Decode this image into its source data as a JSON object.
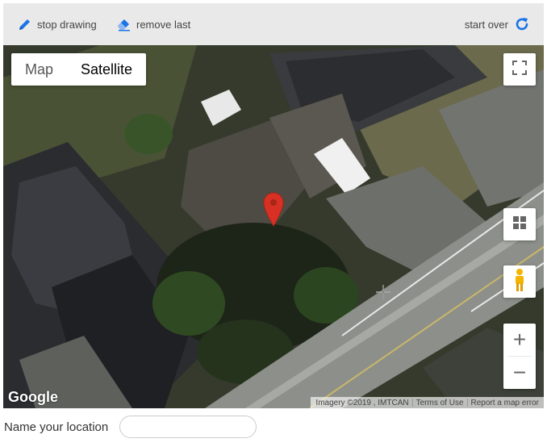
{
  "toolbar": {
    "stop_drawing": "stop drawing",
    "remove_last": "remove last",
    "start_over": "start over",
    "accent": "#1a73e8"
  },
  "map": {
    "type_control": {
      "map": "Map",
      "satellite": "Satellite",
      "selected": "Satellite"
    },
    "controls": [
      "fullscreen-icon",
      "tilt-grid-icon",
      "pegman-icon",
      "zoom-in-icon",
      "zoom-out-icon"
    ],
    "zoom_in": "+",
    "zoom_out": "−",
    "logo": "Google",
    "attribution": {
      "imagery": "Imagery ©2019 , IMTCAN",
      "terms": "Terms of Use",
      "report": "Report a map error"
    },
    "marker_color": "#d93025"
  },
  "form": {
    "label": "Name your location",
    "input_value": "",
    "input_placeholder": ""
  }
}
